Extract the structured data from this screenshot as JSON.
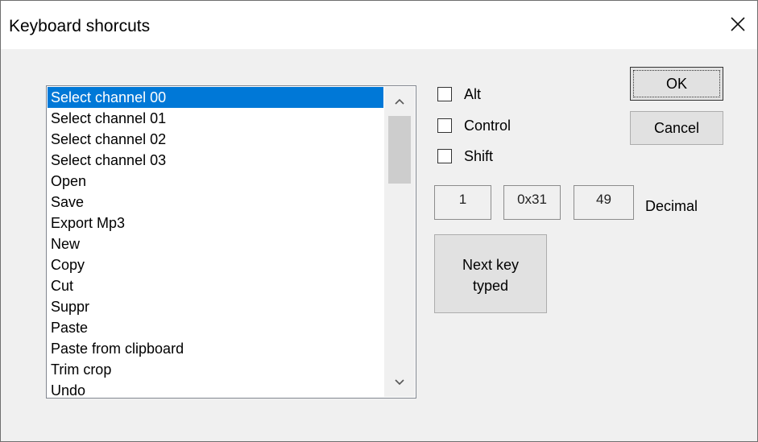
{
  "window": {
    "title": "Keyboard shorcuts",
    "close_icon": "close-icon"
  },
  "shortcut_list": {
    "selected_index": 0,
    "items": [
      "Select channel 00",
      "Select channel 01",
      "Select channel 02",
      "Select channel 03",
      "Open",
      "Save",
      "Export Mp3",
      "New",
      "Copy",
      "Cut",
      "Suppr",
      "Paste",
      "Paste from clipboard",
      "Trim crop",
      "Undo"
    ],
    "scroll_position": 0
  },
  "modifiers": {
    "alt_label": "Alt",
    "alt_checked": false,
    "control_label": "Control",
    "control_checked": false,
    "shift_label": "Shift",
    "shift_checked": false
  },
  "key_code": {
    "char": "1",
    "hex": "0x31",
    "decimal": "49",
    "decimal_label": "Decimal"
  },
  "buttons": {
    "ok": "OK",
    "cancel": "Cancel",
    "next_key_line1": "Next key",
    "next_key_line2": "typed"
  },
  "colors": {
    "selection": "#0078d7",
    "dialog_bg": "#f0f0f0"
  }
}
